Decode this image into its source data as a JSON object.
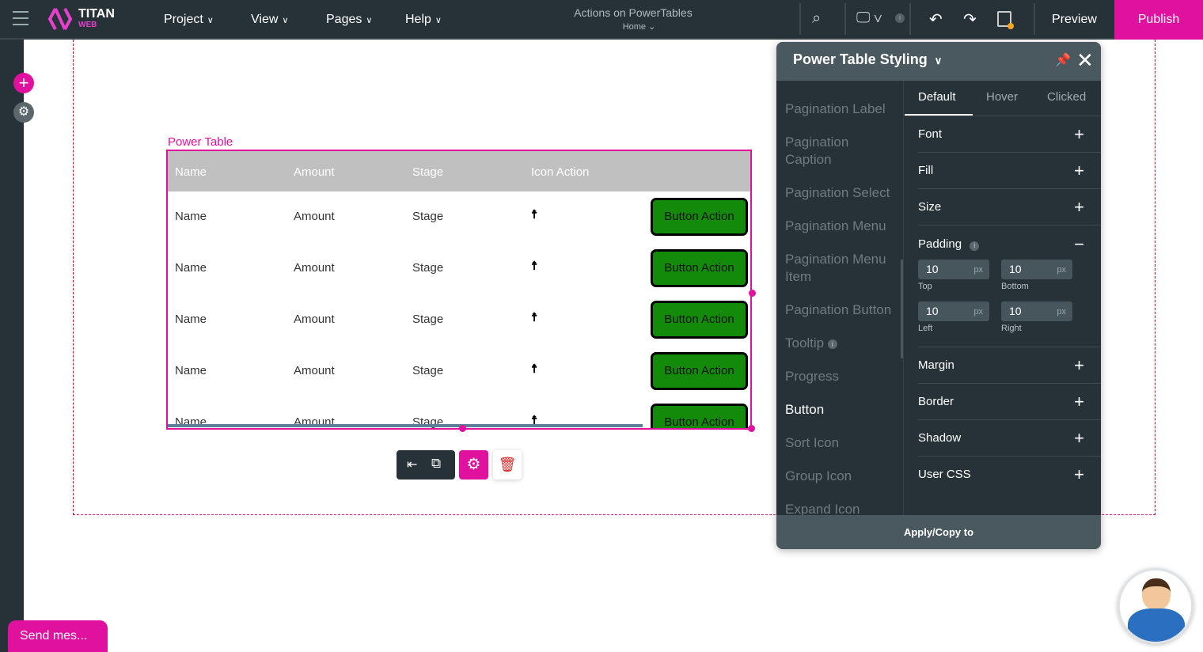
{
  "app": {
    "logo_main": "TITAN",
    "logo_sub": "WEB",
    "menus": [
      "Project",
      "View",
      "Pages",
      "Help"
    ],
    "page_title": "Actions on PowerTables",
    "page_sub": "Home",
    "preview": "Preview",
    "publish": "Publish",
    "accent": "#e0119f"
  },
  "canvas": {
    "component_label": "Power Table",
    "columns": [
      "Name",
      "Amount",
      "Stage",
      "Icon Action"
    ],
    "rows": [
      {
        "name": "Name",
        "amount": "Amount",
        "stage": "Stage",
        "button": "Button Action"
      },
      {
        "name": "Name",
        "amount": "Amount",
        "stage": "Stage",
        "button": "Button Action"
      },
      {
        "name": "Name",
        "amount": "Amount",
        "stage": "Stage",
        "button": "Button Action"
      },
      {
        "name": "Name",
        "amount": "Amount",
        "stage": "Stage",
        "button": "Button Action"
      },
      {
        "name": "Name",
        "amount": "Amount",
        "stage": "Stage",
        "button": "Button Action"
      }
    ],
    "button_color": "#138a0a"
  },
  "panel": {
    "title": "Power Table Styling",
    "list": [
      "Pagination Label",
      "Pagination Caption",
      "Pagination Select",
      "Pagination Menu",
      "Pagination Menu Item",
      "Pagination Button",
      "Tooltip",
      "Progress",
      "Button",
      "Sort Icon",
      "Group Icon",
      "Expand Icon"
    ],
    "selected": "Button",
    "tabs": [
      "Default",
      "Hover",
      "Clicked"
    ],
    "sections": {
      "font": "Font",
      "fill": "Fill",
      "size": "Size",
      "padding": "Padding",
      "margin": "Margin",
      "border": "Border",
      "shadow": "Shadow",
      "user_css": "User CSS"
    },
    "padding": {
      "top": "10",
      "bottom": "10",
      "left": "10",
      "right": "10",
      "unit": "px",
      "labels": {
        "top": "Top",
        "bottom": "Bottom",
        "left": "Left",
        "right": "Right"
      }
    },
    "footer": "Apply/Copy to"
  },
  "chat": {
    "label": "Send mes..."
  }
}
